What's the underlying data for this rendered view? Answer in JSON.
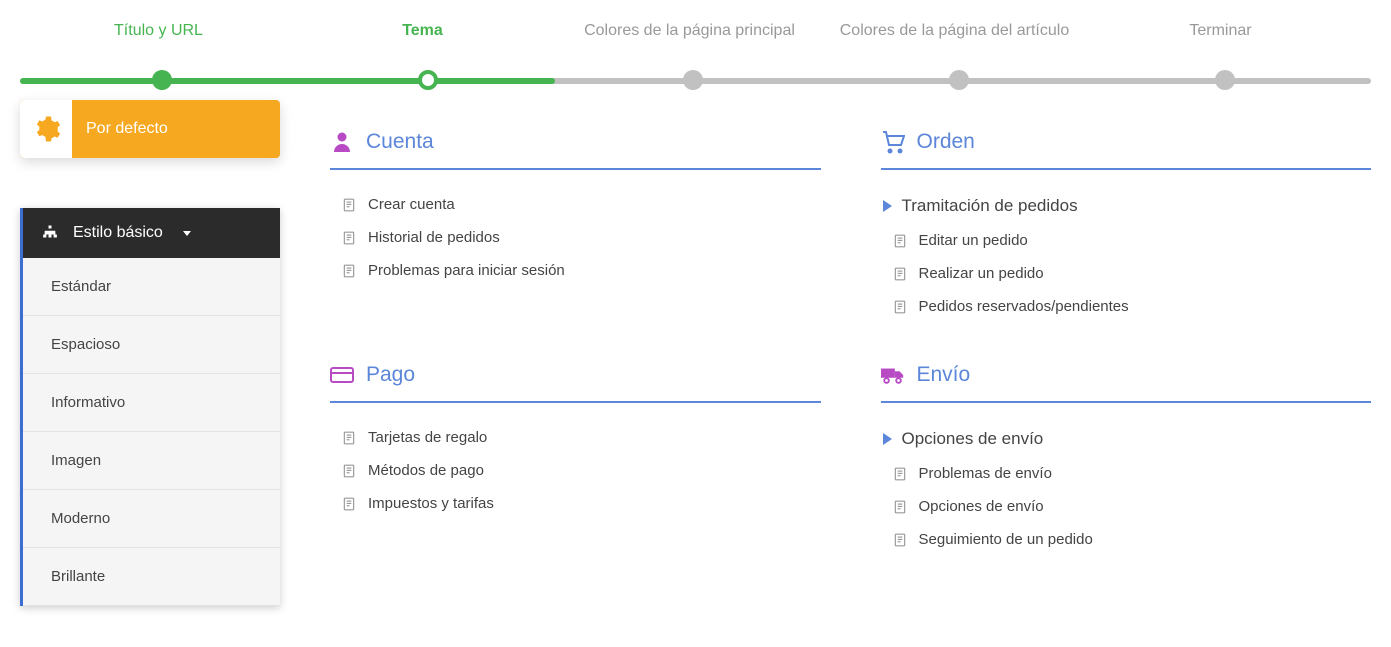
{
  "stepper": {
    "steps": [
      {
        "label": "Título y URL",
        "state": "completed"
      },
      {
        "label": "Tema",
        "state": "active"
      },
      {
        "label": "Colores de la página principal",
        "state": "inactive"
      },
      {
        "label": "Colores de la página del artículo",
        "state": "inactive"
      },
      {
        "label": "Terminar",
        "state": "inactive"
      }
    ]
  },
  "sidebar": {
    "default_button": "Por defecto",
    "style_header": "Estilo básico",
    "style_options": [
      "Estándar",
      "Espacioso",
      "Informativo",
      "Imagen",
      "Moderno",
      "Brillante"
    ]
  },
  "preview": {
    "sections": [
      {
        "icon": "user-icon",
        "icon_color": "#b84bc4",
        "title": "Cuenta",
        "items": [
          {
            "type": "doc",
            "label": "Crear cuenta"
          },
          {
            "type": "doc",
            "label": "Historial de pedidos"
          },
          {
            "type": "doc",
            "label": "Problemas para iniciar sesión"
          }
        ]
      },
      {
        "icon": "cart-icon",
        "icon_color": "#5b86d9",
        "title": "Orden",
        "items": [
          {
            "type": "folder",
            "label": "Tramitación de pedidos"
          },
          {
            "type": "doc",
            "label": "Editar un pedido"
          },
          {
            "type": "doc",
            "label": "Realizar un pedido"
          },
          {
            "type": "doc",
            "label": "Pedidos reservados/pendientes"
          }
        ]
      },
      {
        "icon": "card-icon",
        "icon_color": "#b84bc4",
        "title": "Pago",
        "items": [
          {
            "type": "doc",
            "label": "Tarjetas de regalo"
          },
          {
            "type": "doc",
            "label": "Métodos de pago"
          },
          {
            "type": "doc",
            "label": "Impuestos y tarifas"
          }
        ]
      },
      {
        "icon": "truck-icon",
        "icon_color": "#b84bc4",
        "title": "Envío",
        "items": [
          {
            "type": "folder",
            "label": "Opciones de envío"
          },
          {
            "type": "doc",
            "label": "Problemas de envío"
          },
          {
            "type": "doc",
            "label": "Opciones de envío"
          },
          {
            "type": "doc",
            "label": "Seguimiento de un pedido"
          }
        ]
      }
    ]
  }
}
